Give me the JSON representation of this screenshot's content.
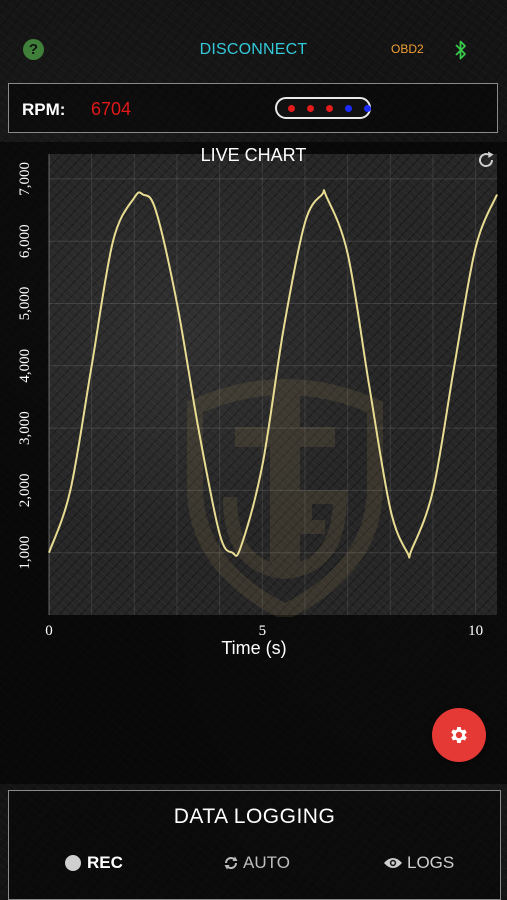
{
  "topbar": {
    "help_icon": "?",
    "disconnect_label": "DISCONNECT",
    "protocol_label": "OBD2",
    "bluetooth_icon": "bluetooth-icon"
  },
  "rpm": {
    "label": "RPM:",
    "value": "6704",
    "shift_light_colors": [
      "#e51b1b",
      "#e51b1b",
      "#e51b1b",
      "#1c2cff",
      "#1c2cff"
    ]
  },
  "chart": {
    "title": "LIVE CHART",
    "refresh_icon": "refresh-icon"
  },
  "chart_data": {
    "type": "line",
    "xlabel": "Time (s)",
    "ylabel": "",
    "xlim": [
      0,
      10.5
    ],
    "ylim": [
      0,
      7400
    ],
    "x_ticks": [
      0,
      5,
      10
    ],
    "x_tick_labels": [
      "0",
      "5",
      "10"
    ],
    "y_ticks": [
      1000,
      2000,
      3000,
      4000,
      5000,
      6000,
      7000
    ],
    "y_tick_labels": [
      "1,000",
      "2,000",
      "3,000",
      "4,000",
      "5,000",
      "6,000",
      "7,000"
    ],
    "grid": true,
    "line_color": "#e8dc92",
    "series": [
      {
        "values_x": [
          0,
          0.5,
          1.0,
          1.5,
          2.0,
          2.2,
          2.5,
          3.0,
          3.5,
          4.0,
          4.3,
          4.5,
          5.0,
          5.5,
          6.0,
          6.4,
          6.5,
          7.0,
          7.5,
          8.0,
          8.4,
          8.5,
          9.0,
          9.5,
          10.0,
          10.5
        ],
        "values_y": [
          1000,
          2000,
          4000,
          6000,
          6700,
          6750,
          6500,
          5000,
          3000,
          1300,
          1000,
          1100,
          2400,
          4600,
          6300,
          6750,
          6720,
          5800,
          3700,
          1700,
          1000,
          1050,
          2000,
          4000,
          5900,
          6750
        ]
      }
    ]
  },
  "settings": {
    "icon": "gear-icon",
    "color": "#e53935"
  },
  "logging": {
    "title": "DATA LOGGING",
    "rec_label": "REC",
    "auto_label": "AUTO",
    "logs_label": "LOGS"
  }
}
